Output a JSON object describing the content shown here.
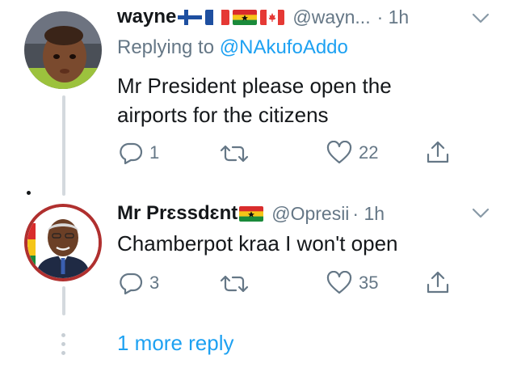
{
  "tweets": [
    {
      "name": "wayne",
      "handle": "@wayn...",
      "time": "· 1h",
      "replying_label": "Replying to",
      "replying_handle": "@NAkufoAddo",
      "text_line1": "Mr President please open the",
      "text_line2": "airports for the citizens",
      "replies": "1",
      "retweets": "",
      "likes": "22",
      "flags": [
        "finland-flag",
        "france-flag",
        "ghana-flag",
        "canada-flag"
      ]
    },
    {
      "name": "Mr Prɛssdɛnt",
      "handle": "@Opresii",
      "time": "· 1h",
      "text_line1": "Chamberpot kraa I won't open",
      "replies": "3",
      "retweets": "",
      "likes": "35",
      "flags": [
        "ghana-flag"
      ]
    }
  ],
  "more_reply_label": "1 more reply",
  "colors": {
    "link": "#1da1f2",
    "secondary_text": "#657786",
    "avatar2_ring": "#b0302f"
  }
}
